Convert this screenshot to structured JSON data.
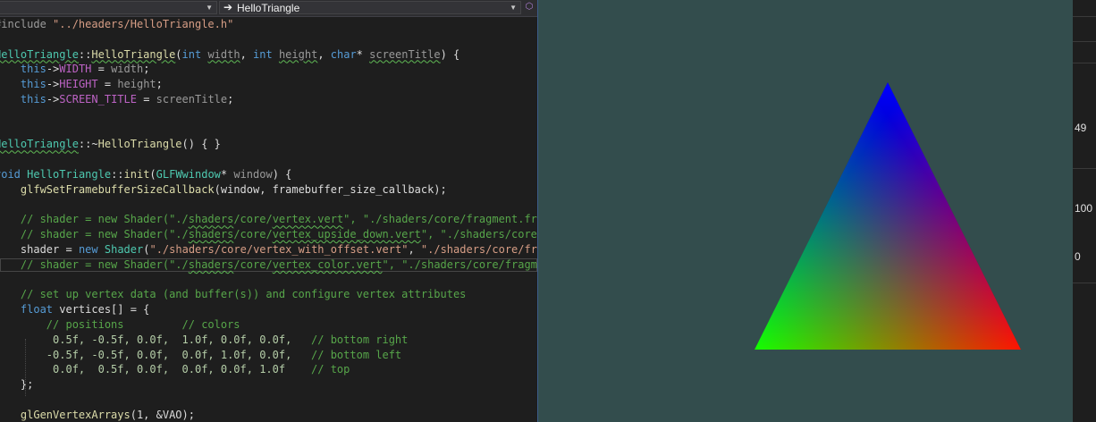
{
  "editor": {
    "nav": {
      "left_value": "",
      "right_value": "HelloTriangle",
      "arrow_glyph": "➔",
      "chevron_glyph": "▼"
    },
    "code": {
      "l1": {
        "a": "#include ",
        "b": "\"../headers/HelloTriangle.h\""
      },
      "l3": {
        "a": "HelloTriangle",
        "b": "::",
        "c": "HelloTriangle",
        "d": "(",
        "e": "int",
        "f": " ",
        "g": "width",
        "h": ", ",
        "i": "int",
        "j": " ",
        "k": "height",
        "l": ", ",
        "m": "char",
        "n": "* ",
        "o": "screenTitle",
        "p": ") {"
      },
      "l4": {
        "a": "    ",
        "b": "this",
        "c": "->",
        "d": "WIDTH",
        "e": " = ",
        "f": "width",
        "g": ";"
      },
      "l5": {
        "a": "    ",
        "b": "this",
        "c": "->",
        "d": "HEIGHT",
        "e": " = ",
        "f": "height",
        "g": ";"
      },
      "l6": {
        "a": "    ",
        "b": "this",
        "c": "->",
        "d": "SCREEN_TITLE",
        "e": " = ",
        "f": "screenTitle",
        "g": ";"
      },
      "l7": {
        "a": "}"
      },
      "l9": {
        "a": "HelloTriangle",
        "b": "::~",
        "c": "HelloTriangle",
        "d": "() { }"
      },
      "l11": {
        "a": "void",
        "b": " ",
        "c": "HelloTriangle",
        "d": "::",
        "e": "init",
        "f": "(",
        "g": "GLFWwindow",
        "h": "* ",
        "i": "window",
        "j": ") {"
      },
      "l12": {
        "a": "    ",
        "b": "glfwSetFramebufferSizeCallback",
        "c": "(window, framebuffer_size_callback);"
      },
      "l14": {
        "a": "    // shader = new Shader(\"./",
        "b": "shaders",
        "c": "/core/",
        "d": "vertex.vert",
        "e": "\", \"./shaders/core/fragment.frag"
      },
      "l15": {
        "a": "    // shader = new Shader(\"./",
        "b": "shaders",
        "c": "/core/",
        "d": "vertex_upside_down.vert",
        "e": "\", \"./shaders/core/f"
      },
      "l16": {
        "a": "    ",
        "b": "shader",
        "c": " = ",
        "d": "new",
        "e": " ",
        "f": "Shader",
        "g": "(",
        "h": "\"./shaders/core/vertex_with_offset.vert\"",
        "i": ", ",
        "j": "\"./shaders/core/frag"
      },
      "l17": {
        "a": "    // shader = new Shader(\"./",
        "b": "shaders",
        "c": "/core/",
        "d": "vertex_color.vert",
        "e": "\", \"./shaders/core/fragmen"
      },
      "l19": {
        "a": "    // set up vertex data (and buffer(s)) and configure vertex attributes"
      },
      "l20": {
        "a": "    ",
        "b": "float",
        "c": " vertices[] = {"
      },
      "l21": {
        "a": "        // positions         // colors"
      },
      "l22": {
        "a": "         0.5f, -0.5f, 0.0f,  1.0f, 0.0f, 0.0f,   ",
        "b": "// bottom right"
      },
      "l23": {
        "a": "        -0.5f, -0.5f, 0.0f,  0.0f, 1.0f, 0.0f,   ",
        "b": "// bottom left"
      },
      "l24": {
        "a": "         0.0f,  0.5f, 0.0f,  0.0f, 0.0f, 1.0f    ",
        "b": "// top"
      },
      "l25": {
        "a": "    };"
      },
      "l27": {
        "a": "    ",
        "b": "glGenVertexArrays",
        "c": "(1, &VAO);"
      }
    }
  },
  "render": {
    "background": "#334d4d",
    "triangle": {
      "top_color": "#0000ff",
      "left_color": "#00ff00",
      "right_color": "#ff0000"
    }
  },
  "side": {
    "n1": "49",
    "n2": "100",
    "n3": "0"
  },
  "colors": {
    "keyword": "#569cd6",
    "type": "#4ec9b0",
    "comment": "#57a64a",
    "string": "#d69d85",
    "function": "#dcdcaa"
  }
}
